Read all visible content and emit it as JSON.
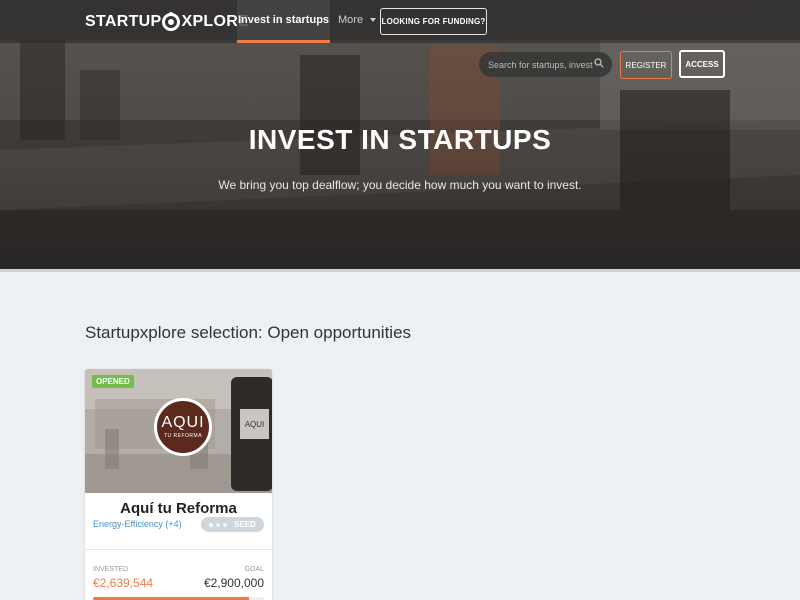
{
  "nav": {
    "logo_left": "STARTUP",
    "logo_right": "XPLORE",
    "active_tab": "Invest in startups",
    "more_label": "More",
    "funding_button": "LOOKING FOR FUNDING?"
  },
  "search": {
    "placeholder": "Search for startups, investors..."
  },
  "auth": {
    "register_label": "REGISTER",
    "access_label": "ACCESS"
  },
  "hero": {
    "title": "INVEST IN STARTUPS",
    "subtitle": "We bring you top dealflow; you decide how much you want to invest."
  },
  "section": {
    "title": "Startupxplore selection: Open opportunities"
  },
  "cards": [
    {
      "status": "OPENED",
      "logo_text": "AQUI",
      "logo_sub": "TU REFORMA",
      "phone_text": "AQUI",
      "name": "Aquí tu Reforma",
      "tags": "Energy-Efficiency (+4)",
      "stage": "SEED",
      "stage_level": 1,
      "invested_label": "INVESTED",
      "invested_value": "€2,639,544",
      "goal_label": "GOAL",
      "goal_value": "€2,900,000",
      "progress": 0.91
    }
  ],
  "colors": {
    "accent": "#f07a47",
    "opened": "#6fbf4a",
    "tag": "#4a8fc5",
    "logo_bg": "#5b2a1d"
  }
}
